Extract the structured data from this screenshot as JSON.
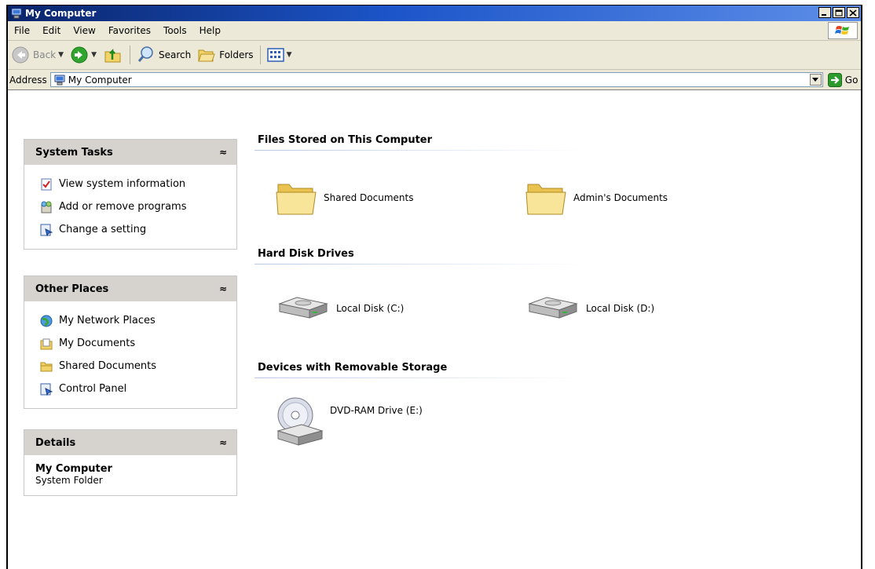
{
  "window": {
    "title": "My Computer"
  },
  "menu": {
    "items": [
      "File",
      "Edit",
      "View",
      "Favorites",
      "Tools",
      "Help"
    ]
  },
  "toolbar": {
    "back_label": "Back",
    "search_label": "Search",
    "folders_label": "Folders"
  },
  "address": {
    "label": "Address",
    "value": "My Computer",
    "go_label": "Go"
  },
  "tasks": {
    "system": {
      "title": "System Tasks",
      "items": [
        "View system information",
        "Add or remove programs",
        "Change a setting"
      ]
    },
    "other": {
      "title": "Other Places",
      "items": [
        "My Network Places",
        "My Documents",
        "Shared Documents",
        "Control Panel"
      ]
    },
    "details": {
      "title": "Details",
      "name": "My Computer",
      "type": "System Folder"
    }
  },
  "groups": {
    "files": {
      "title": "Files Stored on This Computer",
      "items": [
        "Shared Documents",
        "Admin's Documents"
      ]
    },
    "drives": {
      "title": "Hard Disk Drives",
      "items": [
        "Local Disk (C:)",
        "Local Disk (D:)"
      ]
    },
    "removable": {
      "title": "Devices with Removable Storage",
      "items": [
        "DVD-RAM Drive (E:)"
      ]
    }
  },
  "colors": {
    "title_bar": "#0a246a",
    "chrome": "#ece9d8",
    "panel_header": "#d6d3ce",
    "go_green": "#2d9a2d"
  },
  "icons": {
    "window": "computer-icon",
    "folder": "folder-icon",
    "drive": "hard-drive-icon",
    "dvd": "dvd-drive-icon"
  }
}
